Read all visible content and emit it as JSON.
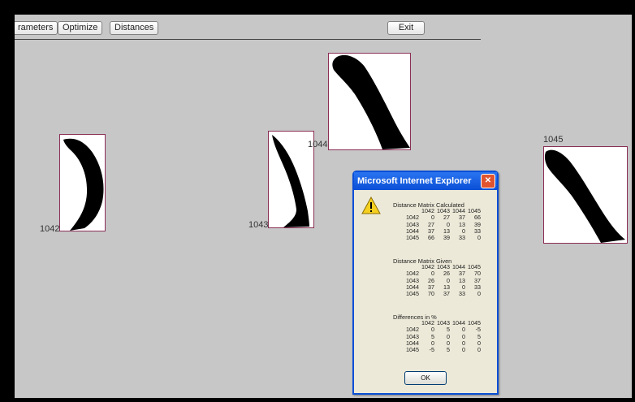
{
  "toolbar": {
    "parameters_label": "rameters",
    "optimize_label": "Optimize",
    "distances_label": "Distances",
    "exit_label": "Exit"
  },
  "tiles": [
    {
      "id": "1042",
      "label": "1042"
    },
    {
      "id": "1043",
      "label": "1043"
    },
    {
      "id": "1044",
      "label": "1044"
    },
    {
      "id": "1045",
      "label": "1045"
    }
  ],
  "dialog": {
    "title": "Microsoft Internet Explorer",
    "close_glyph": "✕",
    "icon": "warning-icon",
    "ok_label": "OK",
    "matrices": [
      {
        "heading": "Distance Matrix Calculated",
        "columns": [
          "1042",
          "1043",
          "1044",
          "1045"
        ],
        "rows": [
          {
            "label": "1042",
            "values": [
              "0",
              "27",
              "37",
              "66"
            ]
          },
          {
            "label": "1043",
            "values": [
              "27",
              "0",
              "13",
              "39"
            ]
          },
          {
            "label": "1044",
            "values": [
              "37",
              "13",
              "0",
              "33"
            ]
          },
          {
            "label": "1045",
            "values": [
              "66",
              "39",
              "33",
              "0"
            ]
          }
        ]
      },
      {
        "heading": "Distance Matrix Given",
        "columns": [
          "1042",
          "1043",
          "1044",
          "1045"
        ],
        "rows": [
          {
            "label": "1042",
            "values": [
              "0",
              "26",
              "37",
              "70"
            ]
          },
          {
            "label": "1043",
            "values": [
              "26",
              "0",
              "13",
              "37"
            ]
          },
          {
            "label": "1044",
            "values": [
              "37",
              "13",
              "0",
              "33"
            ]
          },
          {
            "label": "1045",
            "values": [
              "70",
              "37",
              "33",
              "0"
            ]
          }
        ]
      },
      {
        "heading": "Differences in %",
        "columns": [
          "1042",
          "1043",
          "1044",
          "1045"
        ],
        "rows": [
          {
            "label": "1042",
            "values": [
              "0",
              "5",
              "0",
              "-5"
            ]
          },
          {
            "label": "1043",
            "values": [
              "5",
              "0",
              "0",
              "5"
            ]
          },
          {
            "label": "1044",
            "values": [
              "0",
              "0",
              "0",
              "0"
            ]
          },
          {
            "label": "1045",
            "values": [
              "-5",
              "5",
              "0",
              "0"
            ]
          }
        ]
      }
    ]
  },
  "colors": {
    "canvas": "#c7c7c7",
    "tile_border": "#8a2e55",
    "dialog_title": "#0a4fd6",
    "dialog_body": "#ece9d8",
    "close_button": "#e0542f"
  }
}
